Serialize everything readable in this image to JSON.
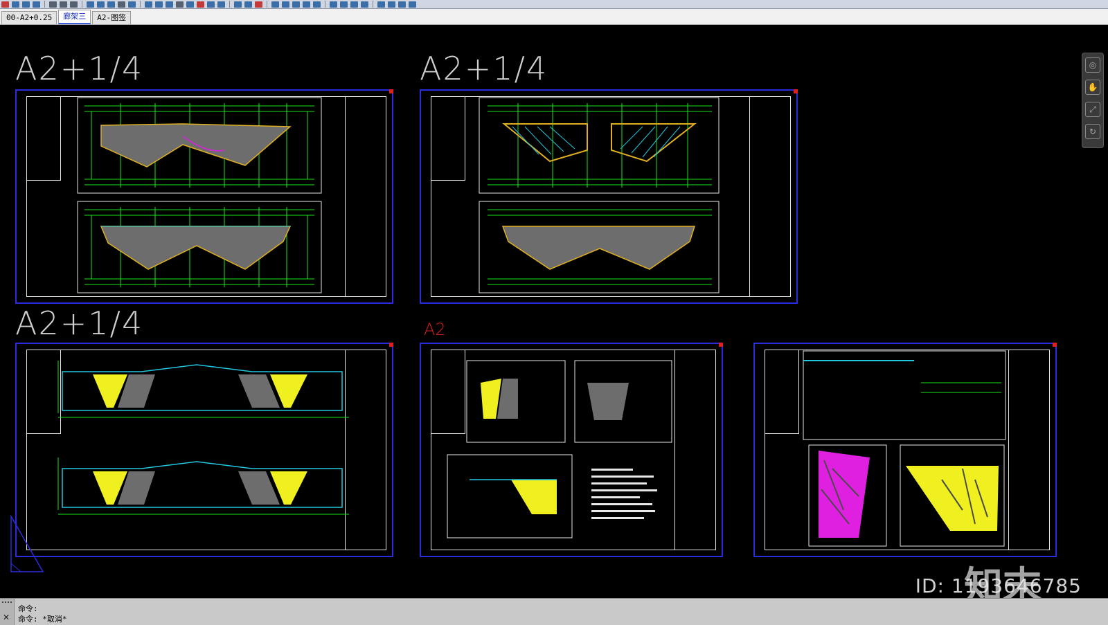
{
  "tabs": [
    {
      "label": "00-A2+0.25"
    },
    {
      "label": "廊架三"
    },
    {
      "label": "A2-图签"
    }
  ],
  "active_tab": 1,
  "sheet_labels": {
    "top_left": "A2+1/4",
    "top_middle": "A2+1/4",
    "bottom_left": "A2+1/4",
    "bottom_middle": "A2"
  },
  "command_line": {
    "line1": "命令:",
    "line2": "命令: *取消*"
  },
  "watermark": {
    "logo": "知末",
    "id": "ID: 1193646785"
  },
  "colors": {
    "background": "#000000",
    "sheet_border": "#2b2be0",
    "dimension": "#19e619",
    "hatch": "#8a8a8a",
    "highlight": "#f0f020",
    "magenta": "#e020e0",
    "cyan": "#20c8e0"
  },
  "icons": [
    "pan-icon",
    "zoom-icon",
    "orbit-icon",
    "steering-wheel-icon"
  ]
}
